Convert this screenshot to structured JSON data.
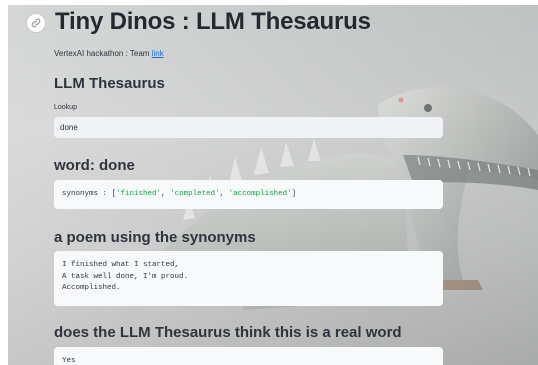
{
  "app": {
    "title": "Tiny Dinos : LLM Thesaurus",
    "subline_text": "VertexAI hackathon : Team ",
    "subline_link": "link"
  },
  "thesaurus": {
    "heading": "LLM Thesaurus",
    "lookup_label": "Lookup",
    "lookup_value": "done"
  },
  "word": {
    "heading": "word: done",
    "synonyms_key": "synonyms",
    "synonyms_sep": " : [",
    "synonyms": [
      "'finished'",
      "'completed'",
      "'accomplished'"
    ],
    "synonyms_comma": ", ",
    "synonyms_close": "]"
  },
  "poem": {
    "heading": "a poem using the synonyms",
    "lines": [
      "I finished what I started,",
      "A task well done, I'm proud.",
      "Accomplished."
    ]
  },
  "real": {
    "heading": "does the LLM Thesaurus think this is a real word",
    "answer": "Yes"
  },
  "icons": {
    "anchor": "link-icon",
    "background": "dinosaur-illustration"
  },
  "colors": {
    "link": "#1c6ed3",
    "string_token": "#09ab3b",
    "text": "#31333f",
    "input_bg": "#f0f2f6"
  }
}
